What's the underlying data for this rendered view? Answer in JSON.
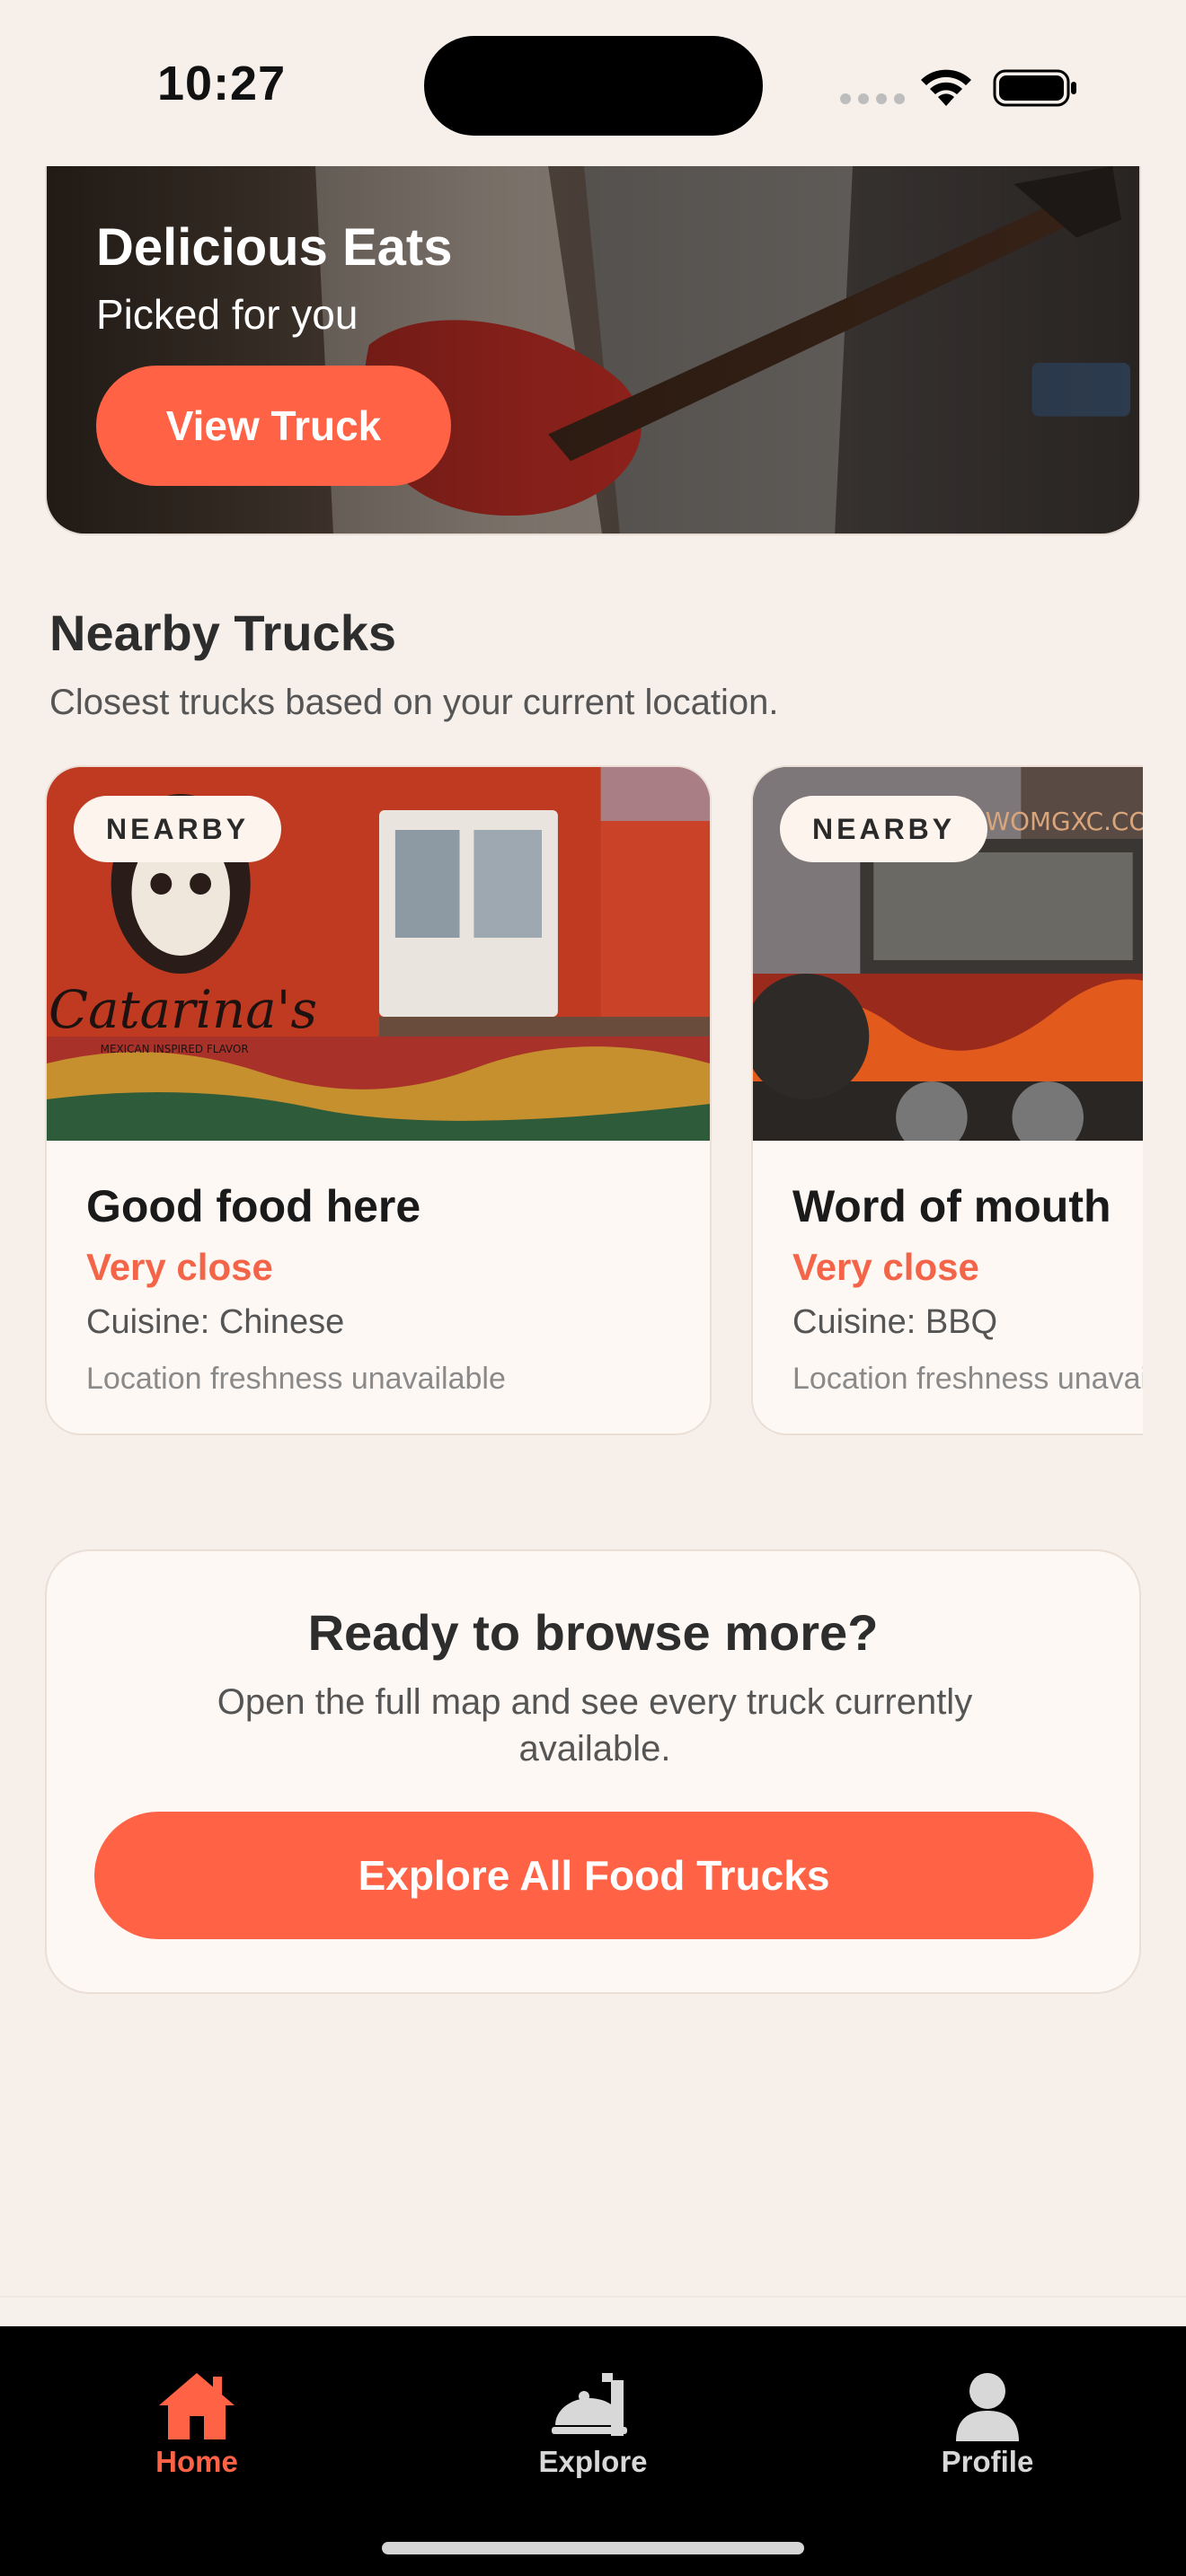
{
  "status_bar": {
    "time": "10:27"
  },
  "hero": {
    "title": "Delicious Eats",
    "subtitle": "Picked for you",
    "button_label": "View Truck"
  },
  "nearby": {
    "title": "Nearby Trucks",
    "subtitle": "Closest trucks based on your current location.",
    "cards": [
      {
        "badge": "NEARBY",
        "name": "Good food here",
        "distance": "Very close",
        "cuisine": "Cuisine: Chinese",
        "freshness": "Location freshness unavailable",
        "image_caption": "Catarina's",
        "image_caption_sub": "MEXICAN INSPIRED FLAVOR"
      },
      {
        "badge": "NEARBY",
        "name": "Word of mouth",
        "distance": "Very close",
        "cuisine": "Cuisine: BBQ",
        "freshness": "Location freshness unavailable",
        "image_caption": "WOMGXC.COM"
      }
    ]
  },
  "browse": {
    "title": "Ready to browse more?",
    "subtitle": "Open the full map and see every truck currently available.",
    "button_label": "Explore All Food Trucks"
  },
  "tab_bar": {
    "tabs": [
      {
        "label": "Home",
        "icon": "home-icon",
        "active": true
      },
      {
        "label": "Explore",
        "icon": "food-cart-icon",
        "active": false
      },
      {
        "label": "Profile",
        "icon": "person-icon",
        "active": false
      }
    ]
  },
  "colors": {
    "accent": "#ff6244",
    "background": "#f6efea",
    "card": "#fdf8f4",
    "tab_bar": "#000000"
  }
}
